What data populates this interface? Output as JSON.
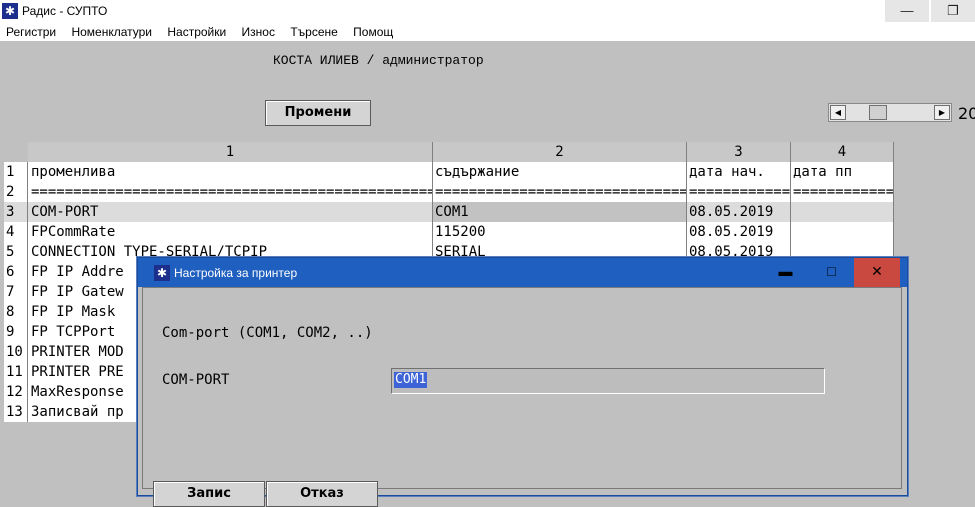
{
  "app": {
    "title": "Радис - СУПТО",
    "icon": "snowflake-icon",
    "minimize_glyph": "—",
    "restore_glyph": "❐"
  },
  "menu": [
    "Регистри",
    "Номенклатури",
    "Настройки",
    "Износ",
    "Търсене",
    "Помощ"
  ],
  "user_line": "КОСТА ИЛИЕВ / администратор",
  "edit_button": "Промени",
  "scroll": {
    "left_arrow": "◀",
    "right_arrow": "▶"
  },
  "page_number": "20",
  "grid": {
    "column_numbers": [
      "1",
      "2",
      "3",
      "4"
    ],
    "rows": [
      {
        "n": "1",
        "c1": "променлива",
        "c2": "съдържание",
        "c3": "дата нач.",
        "c4": "дата пп"
      },
      {
        "n": "2",
        "c1": "==================================================",
        "c2": "==============================",
        "c3": "============",
        "c4": "============"
      },
      {
        "n": "3",
        "c1": "COM-PORT",
        "c2": "COM1",
        "c3": "08.05.2019",
        "c4": ""
      },
      {
        "n": "4",
        "c1": "FPCommRate",
        "c2": "115200",
        "c3": "08.05.2019",
        "c4": ""
      },
      {
        "n": "5",
        "c1": "CONNECTION TYPE-SERIAL/TCPIP",
        "c2": "SERIAL",
        "c3": "08.05.2019",
        "c4": ""
      },
      {
        "n": "6",
        "c1": "FP IP Addre",
        "c2": "",
        "c3": "",
        "c4": ""
      },
      {
        "n": "7",
        "c1": "FP IP Gatew",
        "c2": "",
        "c3": "",
        "c4": ""
      },
      {
        "n": "8",
        "c1": "FP IP Mask",
        "c2": "",
        "c3": "",
        "c4": ""
      },
      {
        "n": "9",
        "c1": "FP TCPPort",
        "c2": "",
        "c3": "",
        "c4": ""
      },
      {
        "n": "10",
        "c1": "PRINTER MOD",
        "c2": "",
        "c3": "",
        "c4": ""
      },
      {
        "n": "11",
        "c1": "PRINTER PRE",
        "c2": "",
        "c3": "",
        "c4": ""
      },
      {
        "n": "12",
        "c1": "MaxResponse",
        "c2": "",
        "c3": "",
        "c4": ""
      },
      {
        "n": "13",
        "c1": "Записвай пр",
        "c2": "",
        "c3": "",
        "c4": ""
      }
    ]
  },
  "dialog": {
    "title": "Настройка за принтер",
    "icon": "snowflake-icon",
    "minimize_glyph": "▬",
    "maximize_glyph": "□",
    "close_glyph": "✕",
    "hint": "Com-port (COM1, COM2, ..)",
    "field_label": "COM-PORT",
    "field_value": "COM1",
    "save_button": "Запис",
    "cancel_button": "Отказ",
    "close_color": "#c9483f"
  }
}
